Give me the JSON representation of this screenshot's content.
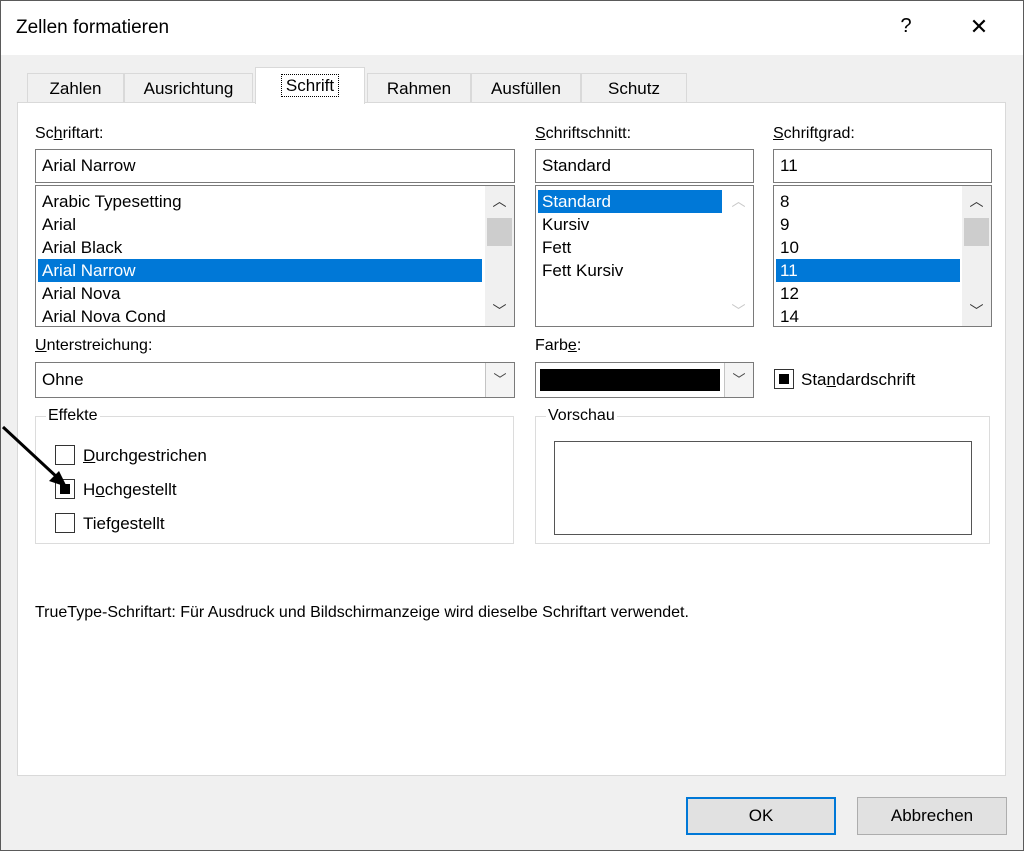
{
  "dialog": {
    "title": "Zellen formatieren",
    "help": "?",
    "close": "✕"
  },
  "tabs": [
    "Zahlen",
    "Ausrichtung",
    "Schrift",
    "Rahmen",
    "Ausfüllen",
    "Schutz"
  ],
  "font": {
    "label_pre": "Sc",
    "label_ul": "h",
    "label_post": "riftart:",
    "value": "Arial Narrow",
    "items": [
      "Arabic Typesetting",
      "Arial",
      "Arial Black",
      "Arial Narrow",
      "Arial Nova",
      "Arial Nova Cond"
    ],
    "selected": "Arial Narrow"
  },
  "style": {
    "label_pre": "",
    "label_ul": "S",
    "label_post": "chriftschnitt:",
    "value": "Standard",
    "items": [
      "Standard",
      "Kursiv",
      "Fett",
      "Fett Kursiv"
    ],
    "selected": "Standard"
  },
  "size": {
    "label_pre": "",
    "label_ul": "S",
    "label_post": "chriftgrad:",
    "value": "11",
    "items": [
      "8",
      "9",
      "10",
      "11",
      "12",
      "14"
    ],
    "selected": "11"
  },
  "underline": {
    "label_pre": "",
    "label_ul": "U",
    "label_post": "nterstreichung:",
    "value": "Ohne"
  },
  "color": {
    "label_pre": "Farb",
    "label_ul": "e",
    "label_post": ":",
    "swatch": "#000000"
  },
  "standard_font": {
    "pre": "Sta",
    "ul": "n",
    "post": "dardschrift",
    "checked": true
  },
  "effects": {
    "title": "Effekte",
    "items": [
      {
        "pre": "",
        "ul": "D",
        "post": "urchgestrichen",
        "checked": false
      },
      {
        "pre": "H",
        "ul": "o",
        "post": "chgestellt",
        "checked": true
      },
      {
        "pre": "Tief",
        "ul": "g",
        "post": "estellt",
        "checked": false
      }
    ]
  },
  "preview": {
    "title": "Vorschau"
  },
  "info": "TrueType-Schriftart: Für Ausdruck und Bildschirmanzeige wird dieselbe Schriftart verwendet.",
  "buttons": {
    "ok": "OK",
    "cancel": "Abbrechen"
  },
  "icons": {
    "scroll_up": "chevron-up-icon",
    "scroll_down": "chevron-down-icon",
    "dropdown": "chevron-down-icon"
  },
  "colors": {
    "selection": "#0078d7",
    "default_button_border": "#0078d7"
  }
}
